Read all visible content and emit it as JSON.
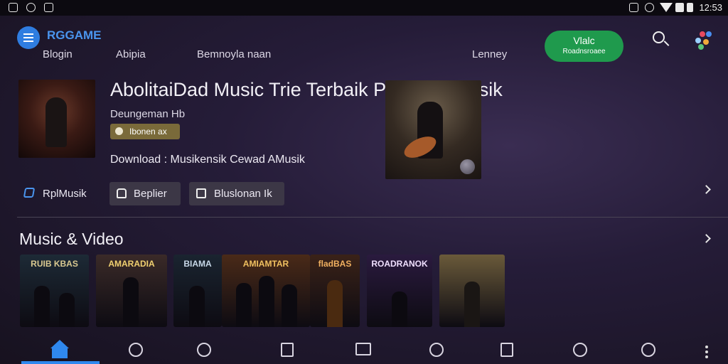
{
  "status_bar": {
    "time": "12:53"
  },
  "header": {
    "brand": "RGGAME",
    "nav": [
      "Blogin",
      "Abipia",
      "Bemnoyla naan",
      "Lenney"
    ],
    "cta": {
      "line1": "Vlalc",
      "line2": "Roadnsroaee"
    }
  },
  "hero": {
    "title": "AbolitaiDad Music Trie Terbaik Pallabsa Musik",
    "subtitle": "Deungeman Hb",
    "badge": "Ibonen ax",
    "download_line": "Download : Musikensik   Cewad AMusik"
  },
  "actions": [
    {
      "label": "RplMusik",
      "icon": "share-icon"
    },
    {
      "label": "Beplier",
      "icon": "tag-icon"
    },
    {
      "label": "Bluslonan Ik",
      "icon": "box-icon"
    }
  ],
  "section": {
    "title": "Music & Video"
  },
  "cards": [
    {
      "caption": "RUIB KBAS",
      "bg": "#1d2a36"
    },
    {
      "caption": "AMARADIA",
      "bg": "#3a2a28"
    },
    {
      "caption": "BIAMA",
      "bg": "#1a2430"
    },
    {
      "caption": "AMIAMTAR",
      "bg": "#4a2a18"
    },
    {
      "caption": "fladBAS",
      "bg": "#3a2218"
    },
    {
      "caption": "ROADRANOK",
      "bg": "#2a1a3e"
    },
    {
      "caption": "",
      "bg": "#6a5a3a"
    }
  ],
  "colors": {
    "accent": "#2f88ee",
    "cta_green": "#1f9a4d",
    "background": "#251c38"
  },
  "bottom_nav": [
    "home-icon",
    "clock-icon",
    "timer-icon",
    "bookmark-icon",
    "inbox-icon",
    "heart-icon",
    "square-icon",
    "refresh-icon",
    "search-clock-icon",
    "more-icon"
  ]
}
